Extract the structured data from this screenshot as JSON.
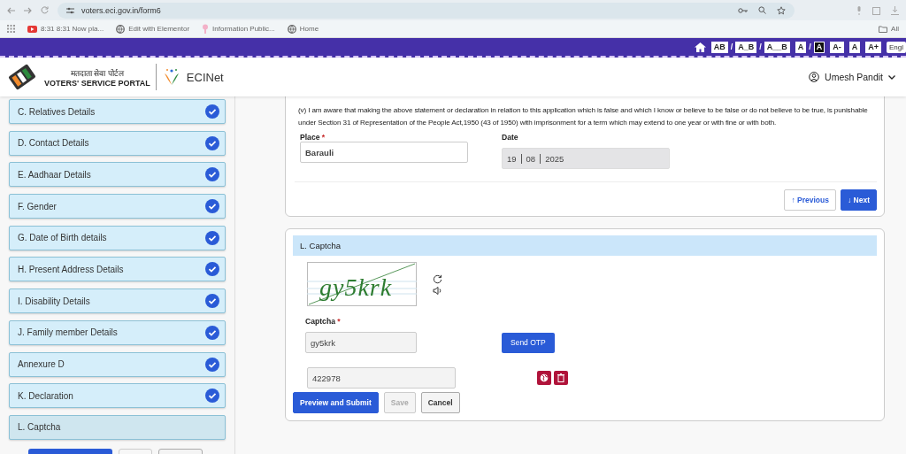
{
  "browser": {
    "url": "voters.eci.gov.in/form6",
    "bookmarks": [
      {
        "label": "8:31 8:31 Now pla...",
        "kind": "video"
      },
      {
        "label": "Edit with Elementor",
        "kind": "globe"
      },
      {
        "label": "Information Public...",
        "kind": "pin"
      },
      {
        "label": "Home",
        "kind": "globe"
      }
    ],
    "all_bookmarks": "All"
  },
  "accessibility_bar": {
    "items": [
      {
        "label": "AB",
        "kind": "box",
        "selected": false
      },
      {
        "label": "/",
        "kind": "sep"
      },
      {
        "label": "A_B",
        "kind": "box",
        "selected": false
      },
      {
        "label": "/",
        "kind": "sep"
      },
      {
        "label": "A__B",
        "kind": "box",
        "selected": false
      },
      {
        "label": "A",
        "kind": "box",
        "selected": false
      },
      {
        "label": "/",
        "kind": "sep"
      },
      {
        "label": "A",
        "kind": "box",
        "selected": true
      },
      {
        "label": "A-",
        "kind": "box",
        "selected": false
      },
      {
        "label": "A",
        "kind": "box",
        "selected": false
      },
      {
        "label": "A+",
        "kind": "box",
        "selected": false
      }
    ],
    "language": "Engl"
  },
  "header": {
    "hindi_title": "मतदाता सेवा पोर्टल",
    "portal_title": "VOTERS' SERVICE PORTAL",
    "brand": "ECINet",
    "user": "Umesh Pandit"
  },
  "sidebar": {
    "items": [
      {
        "label": "C. Relatives Details",
        "completed": true
      },
      {
        "label": "D. Contact Details",
        "completed": true
      },
      {
        "label": "E. Aadhaar Details",
        "completed": true
      },
      {
        "label": "F. Gender",
        "completed": true
      },
      {
        "label": "G. Date of Birth details",
        "completed": true
      },
      {
        "label": "H. Present Address Details",
        "completed": true
      },
      {
        "label": "I. Disability Details",
        "completed": true
      },
      {
        "label": "J. Family member Details",
        "completed": true
      },
      {
        "label": "Annexure D",
        "completed": true
      },
      {
        "label": "K. Declaration",
        "completed": true
      },
      {
        "label": "L. Captcha",
        "completed": false
      }
    ],
    "buttons": [
      {
        "kind": "primary"
      },
      {
        "kind": "disabled"
      },
      {
        "kind": "outline"
      }
    ]
  },
  "declaration": {
    "text": "(v) I am aware that making the above statement or declaration in relation to this application which is false and which I know or believe to be false or do not believe to be true, is punishable under Section 31 of Representation of the People Act,1950 (43 of 1950) with imprisonment for a term which may extend to one year or with fine or with both.",
    "place": {
      "label": "Place",
      "required_mark": "*",
      "value": "Barauli"
    },
    "date": {
      "label": "Date",
      "parts": [
        "19",
        "08",
        "2025"
      ]
    },
    "previous": "↑ Previous",
    "next": "↓ Next"
  },
  "captcha": {
    "title": "L. Captcha",
    "image_text": "gy5krk",
    "label": "Captcha",
    "required_mark": "*",
    "value": "gy5krk",
    "send_otp": "Send OTP",
    "otp_value": "422978",
    "buttons": [
      {
        "label": "Preview and Submit",
        "kind": "primary"
      },
      {
        "label": "Save",
        "kind": "disabled"
      },
      {
        "label": "Cancel",
        "kind": "outline"
      }
    ]
  }
}
